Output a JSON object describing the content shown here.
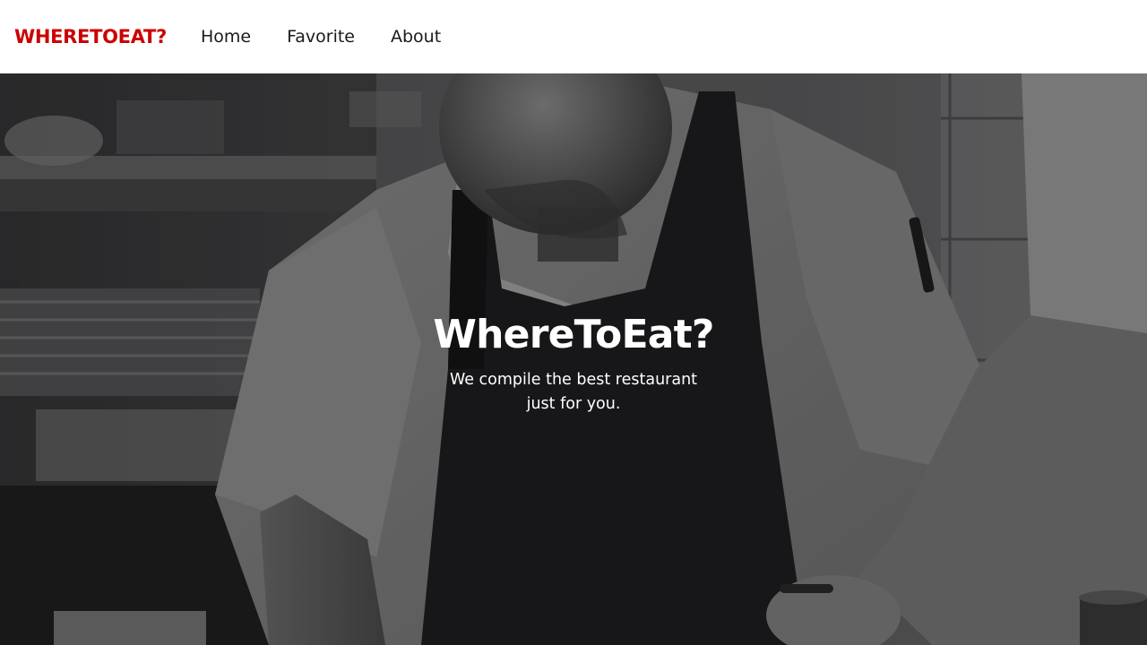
{
  "navbar": {
    "brand": "WHERETOEAT?",
    "links": [
      {
        "label": "Home"
      },
      {
        "label": "Favorite"
      },
      {
        "label": "About"
      }
    ]
  },
  "hero": {
    "title": "WhereToEat?",
    "subtitle": "We compile the best restaurant just for you.",
    "background_image": "grayscale photo of a chef in a white jacket and dark apron working in a kitchen"
  },
  "colors": {
    "brand": "#cc0000",
    "nav_background": "#ffffff",
    "nav_text": "#1a1a1a",
    "hero_text": "#ffffff"
  }
}
